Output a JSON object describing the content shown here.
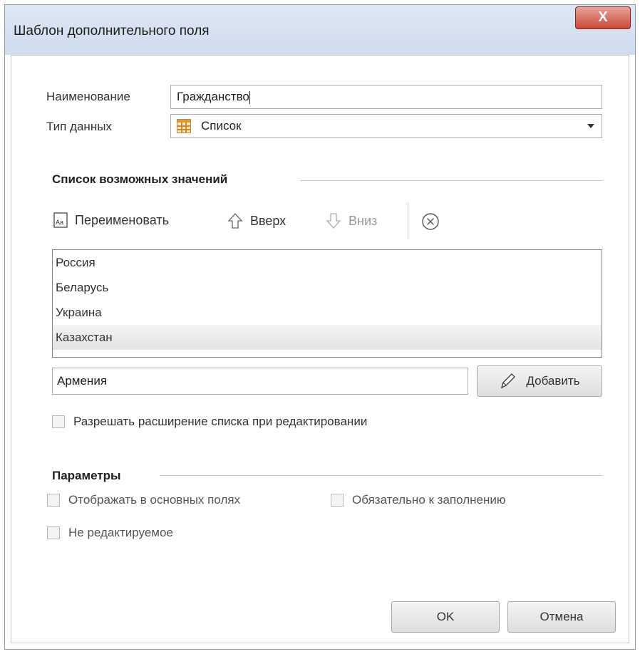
{
  "window": {
    "title": "Шаблон дополнительного поля",
    "close_label": "X"
  },
  "form": {
    "name_label": "Наименование",
    "name_value": "Гражданство",
    "type_label": "Тип данных",
    "type_value": "Список",
    "type_icon": "list-grid-icon"
  },
  "values_section": {
    "title": "Список возможных значений",
    "toolbar": {
      "rename_label": "Переименовать",
      "up_label": "Вверх",
      "down_label": "Вниз"
    },
    "items": [
      "Россия",
      "Беларусь",
      "Украина",
      "Казахстан"
    ],
    "selected_item": "Казахстан",
    "new_value": "Армения",
    "add_label": "Добавить",
    "allow_extend_label": "Разрешать расширение списка при редактировании",
    "allow_extend_checked": false
  },
  "params_section": {
    "title": "Параметры",
    "show_in_main_label": "Отображать в основных полях",
    "show_in_main_checked": false,
    "required_label": "Обязательно к заполнению",
    "required_checked": false,
    "readonly_label": "Не редактируемое",
    "readonly_checked": false
  },
  "footer": {
    "ok_label": "OK",
    "cancel_label": "Отмена"
  }
}
